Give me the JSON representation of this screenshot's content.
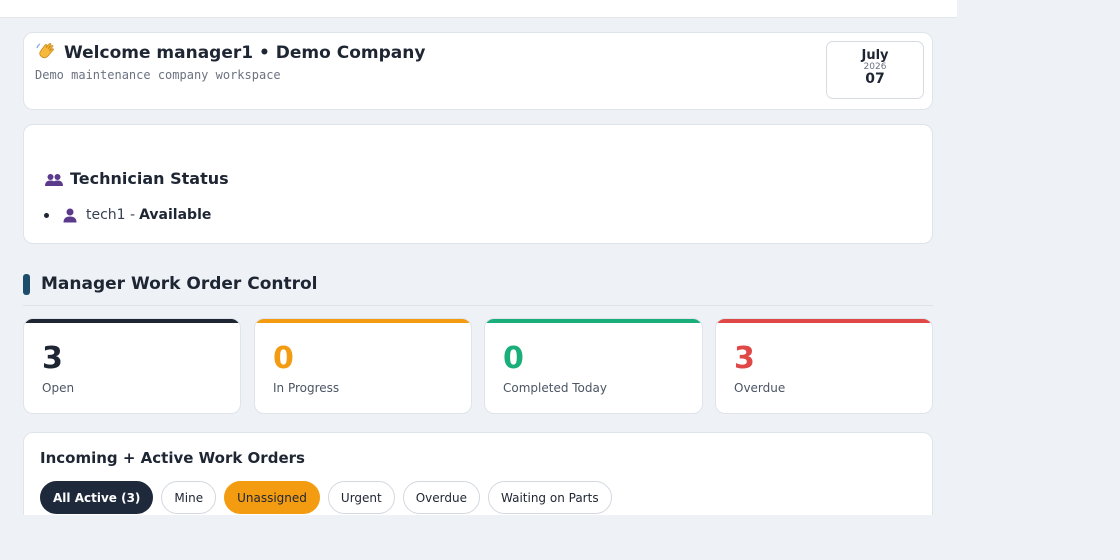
{
  "welcome": {
    "icon": "waving-hand-icon",
    "title": "Welcome manager1 • Demo Company",
    "subtitle": "Demo maintenance company workspace",
    "date": {
      "month": "July",
      "year": "2026",
      "day": "07"
    }
  },
  "technicians": {
    "icon": "people-icon",
    "title": "Technician Status",
    "items": [
      {
        "icon": "person-icon",
        "name": "tech1 -",
        "status": "Available"
      }
    ]
  },
  "control": {
    "title": "Manager Work Order Control",
    "accent": "#1e4d6b",
    "stats": [
      {
        "value": "3",
        "label": "Open",
        "color": "#1e2533"
      },
      {
        "value": "0",
        "label": "In Progress",
        "color": "#f39c12"
      },
      {
        "value": "0",
        "label": "Completed Today",
        "color": "#1aae7a"
      },
      {
        "value": "3",
        "label": "Overdue",
        "color": "#e04848"
      }
    ]
  },
  "orders": {
    "title": "Incoming + Active Work Orders",
    "filters": [
      "All Active (3)",
      "Mine",
      "Unassigned",
      "Urgent",
      "Overdue",
      "Waiting on Parts"
    ],
    "active_filter": "All Active (3)",
    "highlighted_filter": "Unassigned"
  }
}
